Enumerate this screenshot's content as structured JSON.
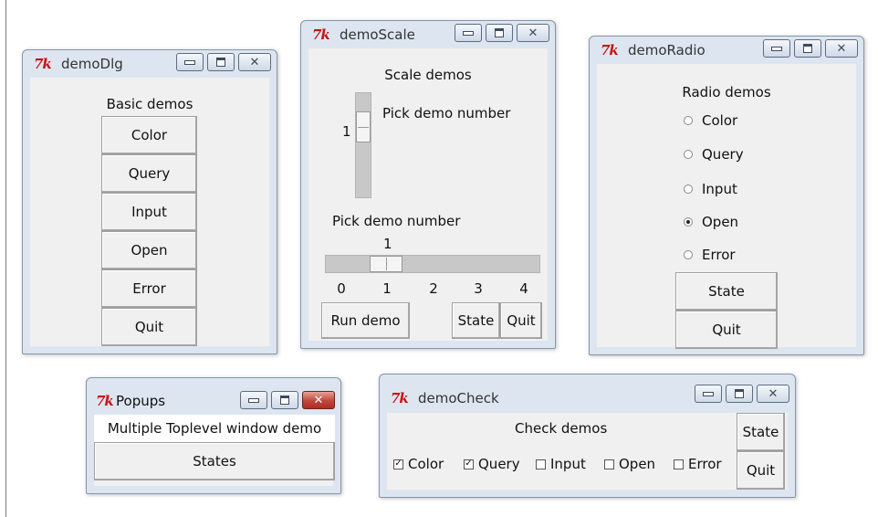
{
  "tk_icon": "7k",
  "demoDlg": {
    "title": "demoDlg",
    "heading": "Basic demos",
    "buttons": [
      "Color",
      "Query",
      "Input",
      "Open",
      "Error",
      "Quit"
    ]
  },
  "demoScale": {
    "title": "demoScale",
    "heading": "Scale demos",
    "vscale": {
      "label": "Pick demo number",
      "value": "1",
      "min": 0,
      "max": 4
    },
    "hscale": {
      "label": "Pick demo number",
      "value": "1",
      "ticks": [
        "0",
        "1",
        "2",
        "3",
        "4"
      ]
    },
    "run_label": "Run demo",
    "state_label": "State",
    "quit_label": "Quit"
  },
  "demoRadio": {
    "title": "demoRadio",
    "heading": "Radio demos",
    "options": [
      {
        "label": "Color",
        "selected": false
      },
      {
        "label": "Query",
        "selected": false
      },
      {
        "label": "Input",
        "selected": false
      },
      {
        "label": "Open",
        "selected": true
      },
      {
        "label": "Error",
        "selected": false
      }
    ],
    "state_label": "State",
    "quit_label": "Quit"
  },
  "popups": {
    "title": "Popups",
    "message": "Multiple Toplevel window demo",
    "button_label": "States"
  },
  "demoCheck": {
    "title": "demoCheck",
    "heading": "Check demos",
    "checks": [
      {
        "label": "Color",
        "checked": true
      },
      {
        "label": "Query",
        "checked": true
      },
      {
        "label": "Input",
        "checked": false
      },
      {
        "label": "Open",
        "checked": false
      },
      {
        "label": "Error",
        "checked": false
      }
    ],
    "state_label": "State",
    "quit_label": "Quit"
  },
  "colors": {
    "client_bg": "#f0f0f0",
    "titlebar_bg": "#dde6f0",
    "close_active": "#c1453a",
    "tk_icon": "#c81010"
  }
}
